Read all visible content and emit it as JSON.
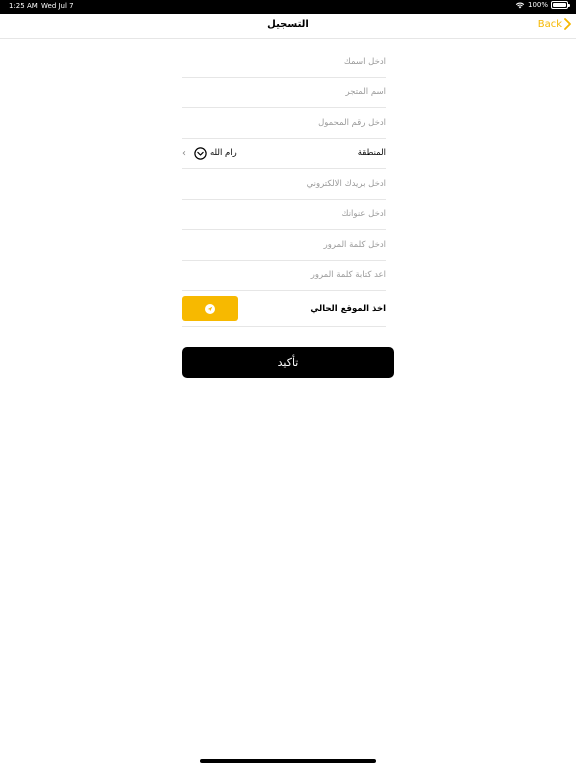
{
  "status_bar": {
    "time": "1:25 AM",
    "date": "Wed Jul 7",
    "battery": "100%",
    "battery_level": 1.0,
    "icons": [
      "wifi-icon",
      "battery-icon"
    ]
  },
  "nav": {
    "title": "التسجيل",
    "back_label": "Back",
    "accent_color": "#f5b700"
  },
  "form": {
    "name_placeholder": "ادخل اسمك",
    "store_placeholder": "اسم المتجر",
    "mobile_placeholder": "ادخل رقم المحمول",
    "region_label": "المنطقة",
    "region_value": "رام الله",
    "email_placeholder": "ادخل بريدك الالكتروني",
    "address_placeholder": "ادخل عنوانك",
    "password_placeholder": "ادخل كلمة المرور",
    "confirm_password_placeholder": "اعد كتابة كلمة المرور",
    "location_label": "اخذ الموقع الحالي",
    "location_button_color": "#f7b900"
  },
  "confirm_label": "تأكيد"
}
